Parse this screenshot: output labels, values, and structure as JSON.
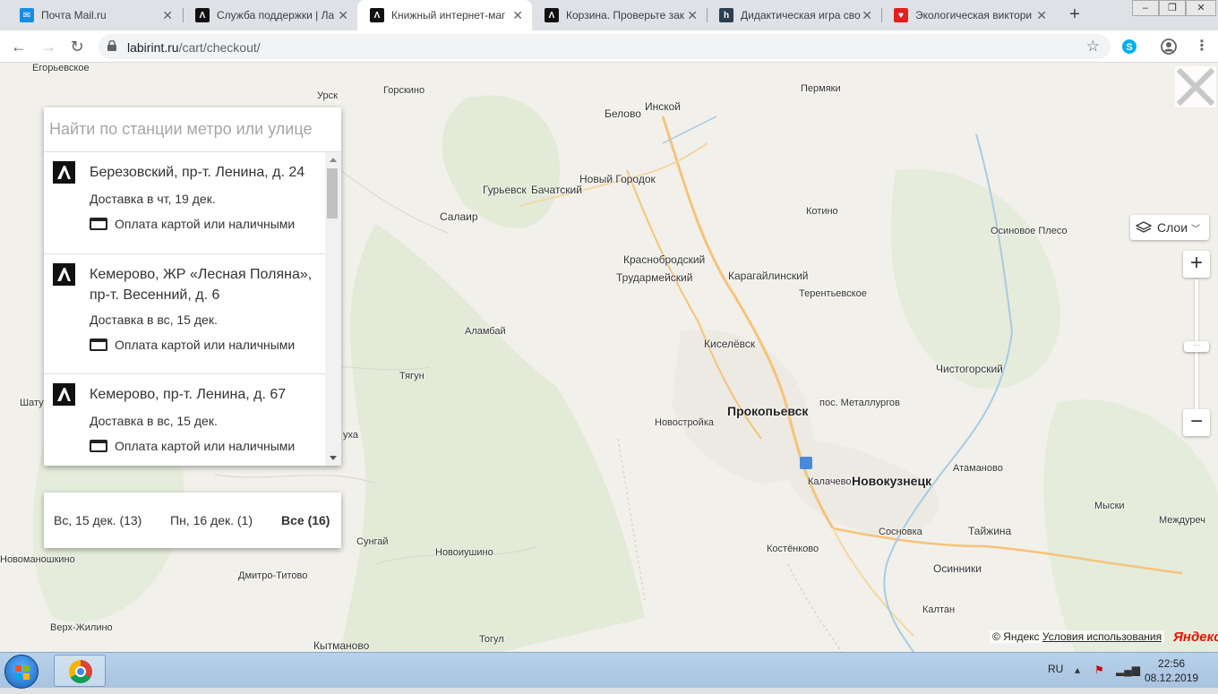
{
  "tabs": [
    {
      "title": "Почта Mail.ru",
      "fav_color": "#168de2",
      "fav_glyph": "✉"
    },
    {
      "title": "Служба поддержки | Ла",
      "fav_color": "#111111",
      "fav_glyph": "Λ"
    },
    {
      "title": "Книжный интернет-маг",
      "fav_color": "#111111",
      "fav_glyph": "Λ"
    },
    {
      "title": "Корзина. Проверьте зак",
      "fav_color": "#111111",
      "fav_glyph": "Λ"
    },
    {
      "title": "Дидактическая игра сво",
      "fav_color": "#2c3e50",
      "fav_glyph": "h"
    },
    {
      "title": "Экологическая виктори",
      "fav_color": "#e02020",
      "fav_glyph": "♥"
    }
  ],
  "new_tab_label": "+",
  "address": {
    "host": "labirint.ru",
    "path": "/cart/checkout/"
  },
  "search": {
    "placeholder": "Найти по станции метро или улице"
  },
  "stores": [
    {
      "address": "Березовский, пр-т. Ленина, д. 24",
      "delivery": "Доставка в чт, 19 дек.",
      "payment": "Оплата картой или наличными"
    },
    {
      "address": "Кемерово, ЖР «Лесная Поляна», пр-т. Весенний, д. 6",
      "delivery": "Доставка в вс, 15 дек.",
      "payment": "Оплата картой или наличными"
    },
    {
      "address": "Кемерово, пр-т. Ленина, д. 67",
      "delivery": "Доставка в вс, 15 дек.",
      "payment": "Оплата картой или наличными"
    }
  ],
  "date_filters": [
    {
      "label": "Вс, 15 дек. (13)"
    },
    {
      "label": "Пн, 16 дек. (1)"
    },
    {
      "label": "Все (16)"
    }
  ],
  "map": {
    "layers_label": "Слои",
    "zoom_in": "+",
    "zoom_out": "−",
    "copyright": "© Яндекс",
    "terms": "Условия использования",
    "logo": "Яндекс",
    "places": [
      {
        "name": "Егорьевское"
      },
      {
        "name": "Урск"
      },
      {
        "name": "Горскино"
      },
      {
        "name": "Белово"
      },
      {
        "name": "Инской"
      },
      {
        "name": "Пермяки"
      },
      {
        "name": "Гурьевск"
      },
      {
        "name": "Бачатский"
      },
      {
        "name": "Новый Городок"
      },
      {
        "name": "Салаир"
      },
      {
        "name": "Котино"
      },
      {
        "name": "Осиновое Плесо"
      },
      {
        "name": "Краснобродский"
      },
      {
        "name": "Трудармейский"
      },
      {
        "name": "Карагайлинский"
      },
      {
        "name": "Терентьевское"
      },
      {
        "name": "Аламбай"
      },
      {
        "name": "Киселёвск"
      },
      {
        "name": "Тягун"
      },
      {
        "name": "Чистогорский"
      },
      {
        "name": "Шату"
      },
      {
        "name": "пос. Металлургов"
      },
      {
        "name": "Прокопьевск"
      },
      {
        "name": "Новостройка"
      },
      {
        "name": "уха"
      },
      {
        "name": "Атаманово"
      },
      {
        "name": "Калачево"
      },
      {
        "name": "Новокузнецк"
      },
      {
        "name": "Мыски"
      },
      {
        "name": "Междуреч"
      },
      {
        "name": "Сосновка"
      },
      {
        "name": "Тайжина"
      },
      {
        "name": "Сунгай"
      },
      {
        "name": "Новоиушино"
      },
      {
        "name": "Костёнково"
      },
      {
        "name": "Новоманошкино"
      },
      {
        "name": "Осинники"
      },
      {
        "name": "Дмитро-Титово"
      },
      {
        "name": "Калтан"
      },
      {
        "name": "Верх-Жилино"
      },
      {
        "name": "Тогул"
      },
      {
        "name": "Кытманово"
      }
    ]
  },
  "taskbar": {
    "lang": "RU",
    "time": "22:56",
    "date": "08.12.2019"
  }
}
